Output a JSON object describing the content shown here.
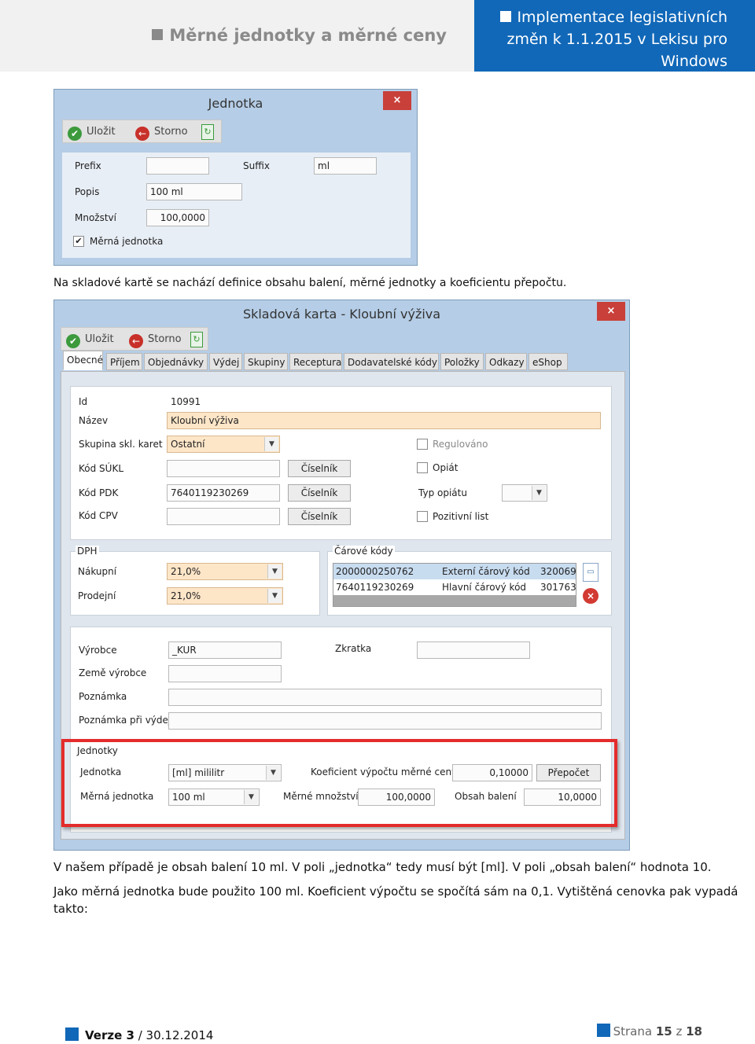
{
  "header": {
    "left_title": "Měrné jednotky a měrné ceny",
    "right_title": "Implementace legislativních změn k 1.1.2015 v Lekisu pro Windows"
  },
  "win1": {
    "title": "Jednotka",
    "close": "×",
    "save": "Uložit",
    "cancel": "Storno",
    "prefix_label": "Prefix",
    "prefix_value": "",
    "suffix_label": "Suffix",
    "suffix_value": "ml",
    "popis_label": "Popis",
    "popis_value": "100 ml",
    "mnozstvi_label": "Množství",
    "mnozstvi_value": "100,0000",
    "merna_label": "Měrná jednotka",
    "merna_checked": "✔"
  },
  "para1": "Na skladové kartě se nachází definice obsahu balení, měrné jednotky a koeficientu přepočtu.",
  "win2": {
    "title": "Skladová karta - Kloubní výživa",
    "close": "×",
    "save": "Uložit",
    "cancel": "Storno",
    "tabs": [
      "Obecné",
      "Příjem",
      "Objednávky",
      "Výdej",
      "Skupiny",
      "Receptura",
      "Dodavatelské kódy",
      "Položky",
      "Odkazy",
      "eShop"
    ],
    "id_label": "Id",
    "id_value": "10991",
    "nazev_label": "Název",
    "nazev_value": "Kloubní výživa",
    "skupina_label": "Skupina skl. karet",
    "skupina_value": "Ostatní",
    "sukl_label": "Kód SÚKL",
    "sukl_value": "",
    "pdk_label": "Kód PDK",
    "pdk_value": "7640119230269",
    "cpv_label": "Kód CPV",
    "cpv_value": "",
    "ciselnik": "Číselník",
    "regulovano": "Regulováno",
    "opiat": "Opiát",
    "typ_opiatu": "Typ opiátu",
    "pozitivni_list": "Pozitivní list",
    "dph_title": "DPH",
    "nakupni_label": "Nákupní",
    "nakupni_value": "21,0%",
    "prodejni_label": "Prodejní",
    "prodejni_value": "21,0%",
    "carove_title": "Čárové kódy",
    "barcodes": [
      {
        "code": "2000000250762",
        "type": "Externí čárový kód",
        "num": "320069"
      },
      {
        "code": "7640119230269",
        "type": "Hlavní čárový kód",
        "num": "301763"
      }
    ],
    "vyrobce_label": "Výrobce",
    "vyrobce_value": "_KUR",
    "zkratka_label": "Zkratka",
    "zkratka_value": "",
    "zeme_label": "Země výrobce",
    "zeme_value": "",
    "poznamka_label": "Poznámka",
    "poznamka_value": "",
    "pozn_vydej_label": "Poznámka při výdeji",
    "pozn_vydej_value": "",
    "jednotky_title": "Jednotky",
    "jednotka_label": "Jednotka",
    "jednotka_value": "[ml] mililitr",
    "koef_label": "Koeficient výpočtu měrné ceny",
    "koef_value": "0,10000",
    "prepocet": "Přepočet",
    "merna_jedn_label": "Měrná jednotka",
    "merna_jedn_value": "100 ml",
    "merne_mnozstvi_label": "Měrné množství",
    "merne_mnozstvi_value": "100,0000",
    "obsah_label": "Obsah balení",
    "obsah_value": "10,0000"
  },
  "para2": "V našem případě je obsah balení 10 ml. V poli „jednotka“ tedy musí být [ml]. V poli „obsah balení“ hodnota 10.",
  "para3": "Jako měrná jednotka bude použito 100 ml. Koeficient výpočtu se spočítá sám na 0,1. Vytištěná cenovka pak vypadá",
  "para4": "takto:",
  "footer": {
    "version_label": "Verze 3",
    "version_date": "/ 30.12.2014",
    "page_label": "Strana",
    "page_current": "15",
    "page_sep": "z",
    "page_total": "18"
  },
  "colors": {
    "brand_blue": "#1168b8",
    "highlight_red": "#e42b2b"
  }
}
